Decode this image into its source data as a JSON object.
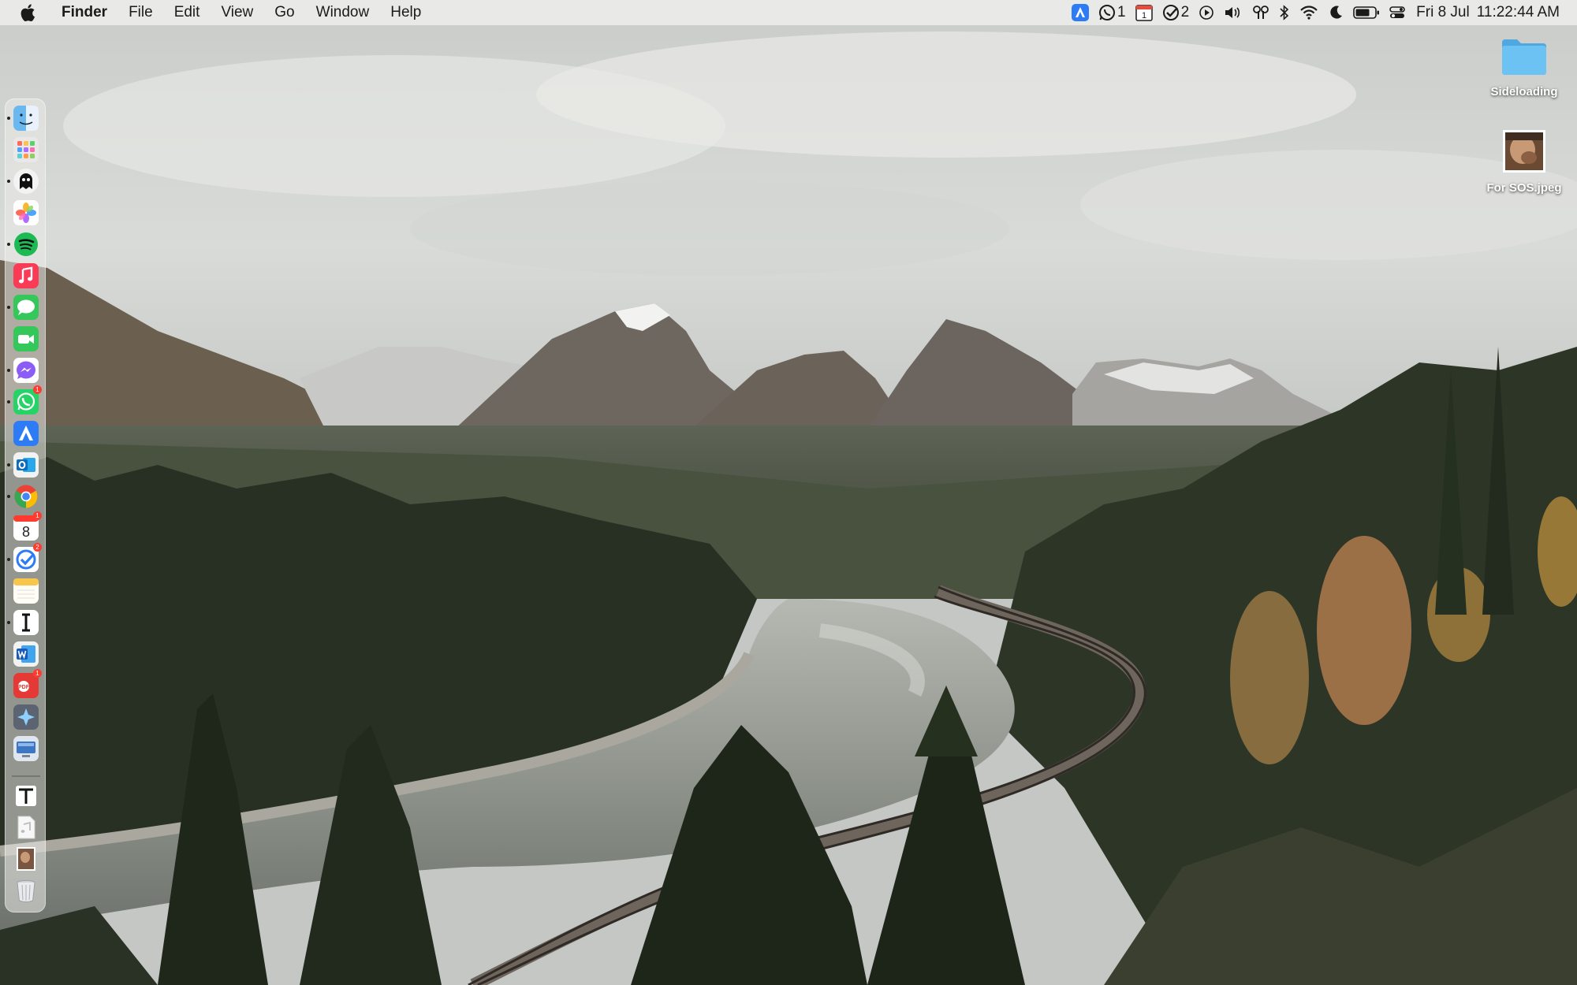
{
  "menubar": {
    "app_name": "Finder",
    "items": [
      "File",
      "Edit",
      "View",
      "Go",
      "Window",
      "Help"
    ],
    "status": {
      "whatsapp_count": "1",
      "calendar_day": "1",
      "tasks_count": "2",
      "date": "Fri 8 Jul",
      "time": "11:22:44 AM"
    }
  },
  "desktop": {
    "icons": [
      {
        "label": "Sideloading",
        "icon": "folder-icon"
      },
      {
        "label": "For SOS.jpeg",
        "icon": "image-file-icon"
      }
    ]
  },
  "dock": {
    "calendar_day": "8",
    "badges": {
      "whatsapp": "1",
      "calendar": "1",
      "tasks": "2",
      "pdf": "1"
    }
  },
  "colors": {
    "menubar_bg": "#ececea",
    "folder_blue": "#6cc3f3",
    "badge_red": "#ff3b30"
  }
}
